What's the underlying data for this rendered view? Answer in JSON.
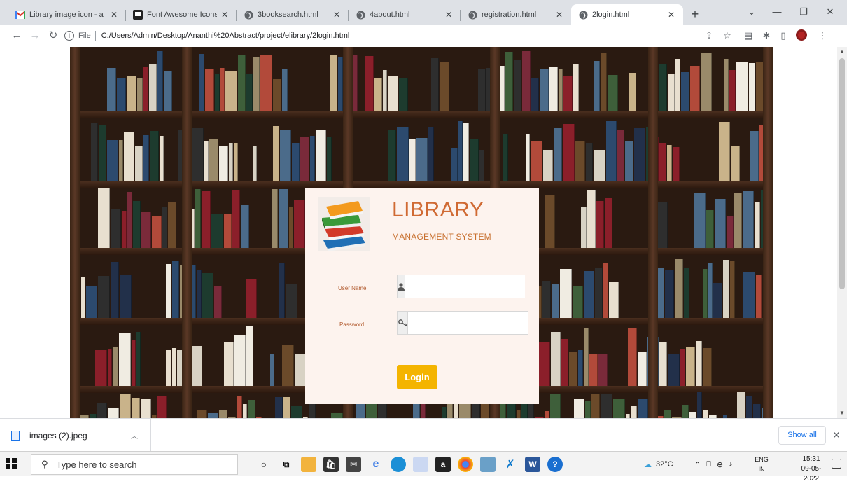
{
  "browser": {
    "tabs": [
      {
        "title": "Library image icon - a",
        "favicon": "gmail-icon",
        "active": false
      },
      {
        "title": "Font Awesome Icons",
        "favicon": "fontawesome-icon",
        "active": false
      },
      {
        "title": "3booksearch.html",
        "favicon": "globe-icon",
        "active": false
      },
      {
        "title": "4about.html",
        "favicon": "globe-icon",
        "active": false
      },
      {
        "title": "registration.html",
        "favicon": "globe-icon",
        "active": false
      },
      {
        "title": "2login.html",
        "favicon": "globe-icon",
        "active": true
      }
    ],
    "new_tab": "+",
    "address": {
      "scheme_label": "File",
      "url": "C:/Users/Admin/Desktop/Ananthi%20Abstract/project/elibrary/2login.html"
    }
  },
  "login": {
    "title": "LIBRARY",
    "subtitle": "MANAGEMENT SYSTEM",
    "username_label": "User Name",
    "username_value": "",
    "password_label": "Password",
    "password_value": "",
    "login_button": "Login"
  },
  "downloads": {
    "file_name": "images (2).jpeg",
    "show_all": "Show all"
  },
  "taskbar": {
    "search_placeholder": "Type here to search",
    "weather": "32°C",
    "language_line1": "ENG",
    "language_line2": "IN",
    "time": "15:31",
    "date": "09-05-2022"
  },
  "colors": {
    "brand_orange": "#d06a33",
    "login_button": "#f4b400",
    "card_background": "#fdf3ee"
  }
}
